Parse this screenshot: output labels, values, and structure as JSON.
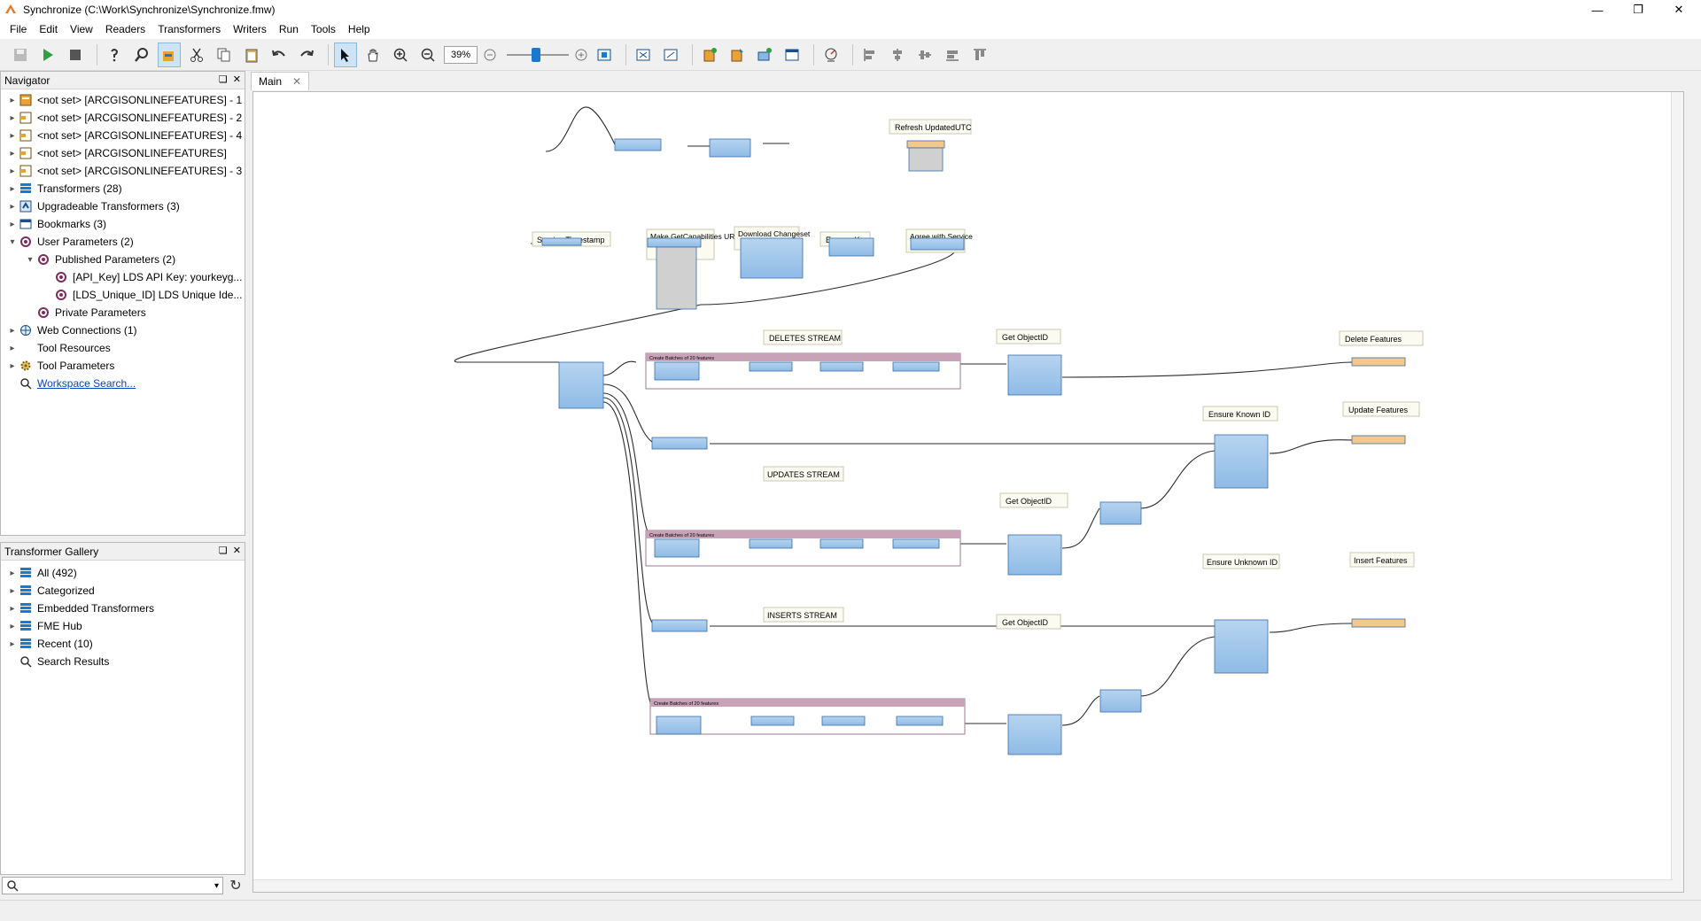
{
  "window": {
    "title": "Synchronize (C:\\Work\\Synchronize\\Synchronize.fmw)"
  },
  "menu": [
    "File",
    "Edit",
    "View",
    "Readers",
    "Transformers",
    "Writers",
    "Run",
    "Tools",
    "Help"
  ],
  "toolbar": {
    "zoom": "39%"
  },
  "navigator": {
    "title": "Navigator",
    "items": [
      {
        "label": "<not set> [ARCGISONLINEFEATURES] - 1",
        "icon": "reader-icon"
      },
      {
        "label": "<not set> [ARCGISONLINEFEATURES] - 2",
        "icon": "writer-icon"
      },
      {
        "label": "<not set> [ARCGISONLINEFEATURES] - 4",
        "icon": "writer-icon"
      },
      {
        "label": "<not set> [ARCGISONLINEFEATURES]",
        "icon": "writer-icon"
      },
      {
        "label": "<not set> [ARCGISONLINEFEATURES] - 3",
        "icon": "writer-icon"
      },
      {
        "label": "Transformers (28)",
        "icon": "transformer-icon"
      },
      {
        "label": "Upgradeable Transformers (3)",
        "icon": "upgrade-icon"
      },
      {
        "label": "Bookmarks (3)",
        "icon": "bookmark-icon"
      },
      {
        "label": "User Parameters (2)",
        "icon": "parameters-icon"
      },
      {
        "label": "Published Parameters (2)",
        "icon": "parameters-icon"
      },
      {
        "label": "[API_Key] LDS API Key: yourkeyg...",
        "icon": "parameter-icon"
      },
      {
        "label": "[LDS_Unique_ID] LDS Unique Ide...",
        "icon": "parameter-icon"
      },
      {
        "label": "Private Parameters",
        "icon": "parameters-icon"
      },
      {
        "label": "Web Connections (1)",
        "icon": "web-icon"
      },
      {
        "label": "Tool Resources",
        "icon": "resources-icon"
      },
      {
        "label": "Tool Parameters",
        "icon": "gear-icon"
      },
      {
        "label": "Workspace Search...",
        "icon": "search-icon"
      }
    ]
  },
  "gallery": {
    "title": "Transformer Gallery",
    "items": [
      {
        "label": "All (492)"
      },
      {
        "label": "Categorized"
      },
      {
        "label": "Embedded Transformers"
      },
      {
        "label": "FME Hub"
      },
      {
        "label": "Recent (10)"
      },
      {
        "label": "Search Results"
      }
    ]
  },
  "tabs": [
    {
      "label": "Main"
    }
  ],
  "canvas": {
    "annotations": [
      "Refresh UpdatedUTC",
      "Service Timestamp",
      "Make GetCapabilities URL",
      "Download Changeset",
      "Expose Keys",
      "Agree with Service",
      "DELETES STREAM",
      "Get ObjectID",
      "Delete Features",
      "Ensure Known ID",
      "Update Features",
      "UPDATES STREAM",
      "Get ObjectID",
      "Ensure Unknown ID",
      "Insert Features",
      "INSERTS STREAM",
      "Get ObjectID"
    ],
    "bookmarks": [
      "Create Batches of 20 features",
      "Create Batches of 20 features",
      "Create Batches of 20 features"
    ]
  }
}
